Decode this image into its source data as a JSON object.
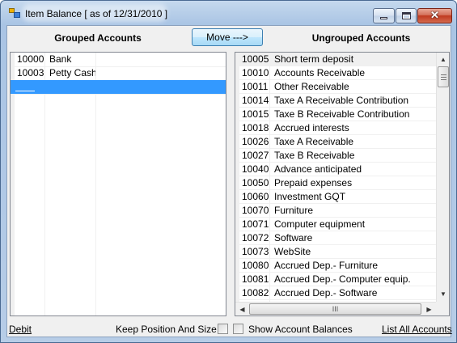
{
  "window": {
    "title": "Item Balance [ as of 12/31/2010 ]",
    "close_glyph": "✕"
  },
  "header": {
    "grouped_title": "Grouped Accounts",
    "ungrouped_title": "Ungrouped Accounts",
    "move_button": "Move --->"
  },
  "grouped": {
    "rows": [
      {
        "code": "10000",
        "name": "Bank"
      },
      {
        "code": "10003",
        "name": "Petty Cash"
      }
    ],
    "selected_row": {
      "code": "",
      "name": ""
    }
  },
  "ungrouped": {
    "rows": [
      {
        "code": "10005",
        "name": "Short term deposit"
      },
      {
        "code": "10010",
        "name": "Accounts Receivable"
      },
      {
        "code": "10011",
        "name": "Other Receivable"
      },
      {
        "code": "10014",
        "name": "Taxe A Receivable Contribution"
      },
      {
        "code": "10015",
        "name": "Taxe B Receivable Contribution"
      },
      {
        "code": "10018",
        "name": "Accrued interests"
      },
      {
        "code": "10026",
        "name": "Taxe A Receivable"
      },
      {
        "code": "10027",
        "name": "Taxe B Receivable"
      },
      {
        "code": "10040",
        "name": "Advance anticipated"
      },
      {
        "code": "10050",
        "name": "Prepaid expenses"
      },
      {
        "code": "10060",
        "name": "Investment GQT"
      },
      {
        "code": "10070",
        "name": "Furniture"
      },
      {
        "code": "10071",
        "name": "Computer equipment"
      },
      {
        "code": "10072",
        "name": "Software"
      },
      {
        "code": "10073",
        "name": "WebSite"
      },
      {
        "code": "10080",
        "name": "Accrued Dep.- Furniture"
      },
      {
        "code": "10081",
        "name": "Accrued Dep.- Computer equip."
      },
      {
        "code": "10082",
        "name": "Accrued Dep.- Software"
      }
    ],
    "scroll_up": "▲",
    "scroll_down": "▼",
    "scroll_left": "◀",
    "scroll_right": "▶",
    "hscroll_grip": "III"
  },
  "footer": {
    "debit_link": "Debit",
    "keep_position_label": "Keep Position And Size",
    "keep_position_checked": false,
    "show_balances_label": "Show Account Balances",
    "show_balances_checked": false,
    "list_all_link": "List All Accounts"
  },
  "colors": {
    "selection": "#3399ff",
    "window_frame": "#b8cfe9",
    "close_button": "#c0391f"
  }
}
